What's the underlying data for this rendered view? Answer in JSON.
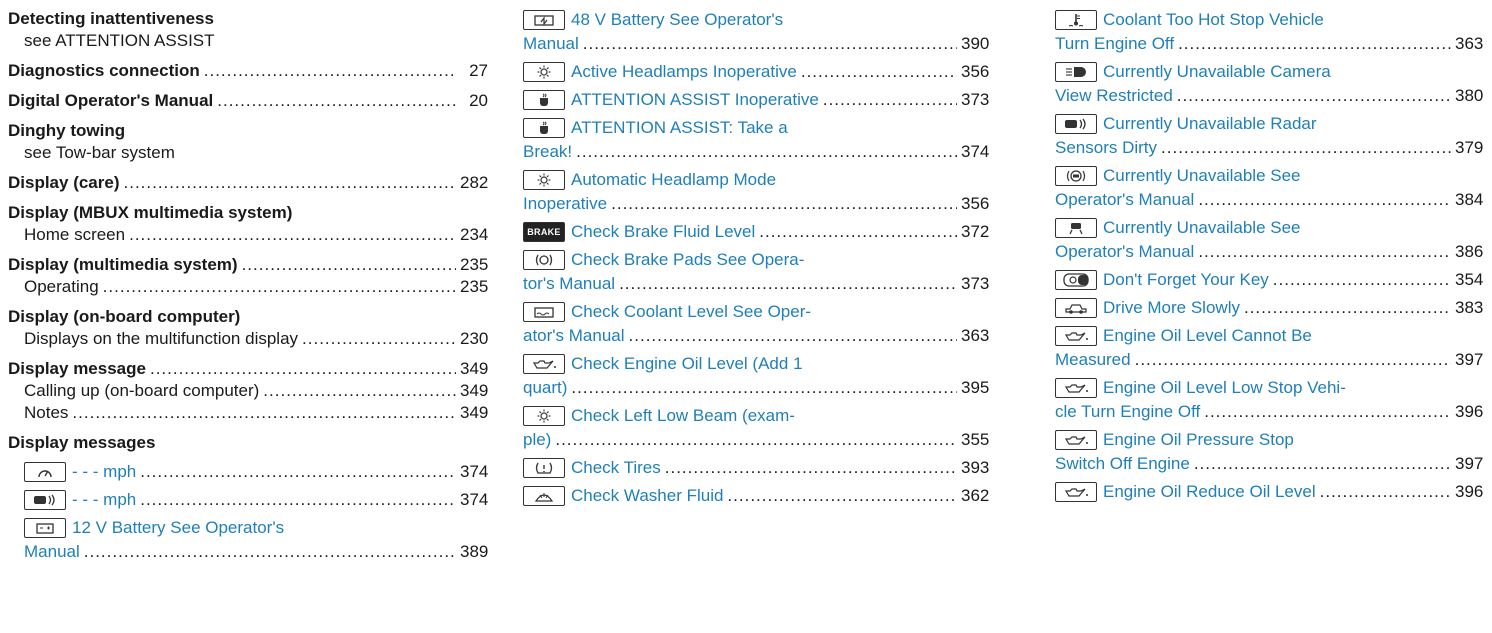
{
  "col1": [
    {
      "kind": "head",
      "text": "Detecting inattentiveness",
      "page": ""
    },
    {
      "kind": "see",
      "text": "see ATTENTION ASSIST",
      "page": ""
    },
    {
      "kind": "head",
      "text": "Diagnostics connection",
      "page": "27"
    },
    {
      "kind": "head",
      "text": "Digital Operator's Manual",
      "page": "20"
    },
    {
      "kind": "head",
      "text": "Dinghy towing",
      "page": ""
    },
    {
      "kind": "see",
      "text": "see Tow-bar system",
      "page": ""
    },
    {
      "kind": "head",
      "text": "Display (care)",
      "page": "282"
    },
    {
      "kind": "head",
      "text": "Display (MBUX multimedia system)",
      "page": ""
    },
    {
      "kind": "sub",
      "text": "Home screen",
      "page": "234"
    },
    {
      "kind": "head",
      "text": "Display (multimedia system)",
      "page": "235"
    },
    {
      "kind": "sub",
      "text": "Operating",
      "page": "235"
    },
    {
      "kind": "head",
      "text": "Display (on-board computer)",
      "page": ""
    },
    {
      "kind": "sub",
      "text": "Displays on the multifunction display",
      "page": "230"
    },
    {
      "kind": "head",
      "text": "Display message",
      "page": "349"
    },
    {
      "kind": "sub",
      "text": "Calling up (on-board computer)",
      "page": "349"
    },
    {
      "kind": "sub",
      "text": "Notes",
      "page": "349"
    },
    {
      "kind": "head",
      "text": "Display messages",
      "page": ""
    }
  ],
  "col1_msgs": [
    {
      "icon": "speedometer-icon",
      "text": "- - - mph",
      "page": "374"
    },
    {
      "icon": "radar-sensor-icon",
      "text": "- - - mph",
      "page": "374"
    },
    {
      "icon": "battery-icon",
      "text": "12 V Battery See Operator's",
      "page": ""
    },
    {
      "icon": "",
      "text": "Manual",
      "page": "389"
    }
  ],
  "col2": [
    {
      "icon": "48v-battery-icon",
      "text": "48 V Battery See Operator's",
      "page": ""
    },
    {
      "icon": "",
      "text": "Manual",
      "page": "390"
    },
    {
      "icon": "headlamp-icon",
      "text": "Active Headlamps Inoperative",
      "page": "356"
    },
    {
      "icon": "attention-cup-icon",
      "text": "ATTENTION ASSIST Inoperative",
      "page": "373"
    },
    {
      "icon": "attention-cup-icon",
      "text": "ATTENTION ASSIST: Take a",
      "page": ""
    },
    {
      "icon": "",
      "text": "Break!",
      "page": "374"
    },
    {
      "icon": "headlamp-icon",
      "text": "Automatic Headlamp Mode",
      "page": ""
    },
    {
      "icon": "",
      "text": "Inoperative",
      "page": "356"
    },
    {
      "icon": "brake-icon",
      "text": "Check Brake Fluid Level",
      "page": "372"
    },
    {
      "icon": "brake-pad-icon",
      "text": "Check Brake Pads See Opera-",
      "page": ""
    },
    {
      "icon": "",
      "text": "tor's Manual",
      "page": "373"
    },
    {
      "icon": "coolant-level-icon",
      "text": "Check Coolant Level See Oper-",
      "page": ""
    },
    {
      "icon": "",
      "text": "ator's Manual",
      "page": "363"
    },
    {
      "icon": "oil-can-icon",
      "text": "Check Engine Oil Level (Add 1",
      "page": ""
    },
    {
      "icon": "",
      "text": "quart)",
      "page": "395"
    },
    {
      "icon": "headlamp-icon",
      "text": "Check Left Low Beam (exam-",
      "page": ""
    },
    {
      "icon": "",
      "text": "ple)",
      "page": "355"
    },
    {
      "icon": "tire-pressure-icon",
      "text": "Check Tires",
      "page": "393"
    },
    {
      "icon": "washer-fluid-icon",
      "text": "Check Washer Fluid",
      "page": "362"
    }
  ],
  "col3": [
    {
      "icon": "coolant-temp-icon",
      "text": "Coolant Too Hot Stop Vehicle",
      "page": ""
    },
    {
      "icon": "",
      "text": "Turn Engine Off",
      "page": "363"
    },
    {
      "icon": "camera-icon",
      "text": "Currently Unavailable Camera",
      "page": ""
    },
    {
      "icon": "",
      "text": "View Restricted",
      "page": "380"
    },
    {
      "icon": "radar-sensor-icon",
      "text": "Currently Unavailable Radar",
      "page": ""
    },
    {
      "icon": "",
      "text": "Sensors Dirty",
      "page": "379"
    },
    {
      "icon": "abs-icon",
      "text": "Currently Unavailable See",
      "page": ""
    },
    {
      "icon": "",
      "text": "Operator's Manual",
      "page": "384"
    },
    {
      "icon": "lane-assist-icon",
      "text": "Currently Unavailable See",
      "page": ""
    },
    {
      "icon": "",
      "text": "Operator's Manual",
      "page": "386"
    },
    {
      "icon": "key-icon",
      "text": "Don't Forget Your Key",
      "page": "354"
    },
    {
      "icon": "slippery-road-icon",
      "text": "Drive More Slowly",
      "page": "383"
    },
    {
      "icon": "oil-can-icon",
      "text": "Engine Oil Level Cannot Be",
      "page": ""
    },
    {
      "icon": "",
      "text": "Measured",
      "page": "397"
    },
    {
      "icon": "oil-can-icon",
      "text": "Engine Oil Level Low Stop Vehi-",
      "page": ""
    },
    {
      "icon": "",
      "text": "cle Turn Engine Off",
      "page": "396"
    },
    {
      "icon": "oil-can-icon",
      "text": "Engine Oil Pressure Stop",
      "page": ""
    },
    {
      "icon": "",
      "text": "Switch Off Engine",
      "page": "397"
    },
    {
      "icon": "oil-can-icon",
      "text": "Engine Oil Reduce Oil Level",
      "page": "396"
    }
  ],
  "icon_labels": {
    "brake-icon": "BRAKE"
  },
  "colors": {
    "link": "#1f7fb8",
    "text": "#1a1a1a"
  }
}
